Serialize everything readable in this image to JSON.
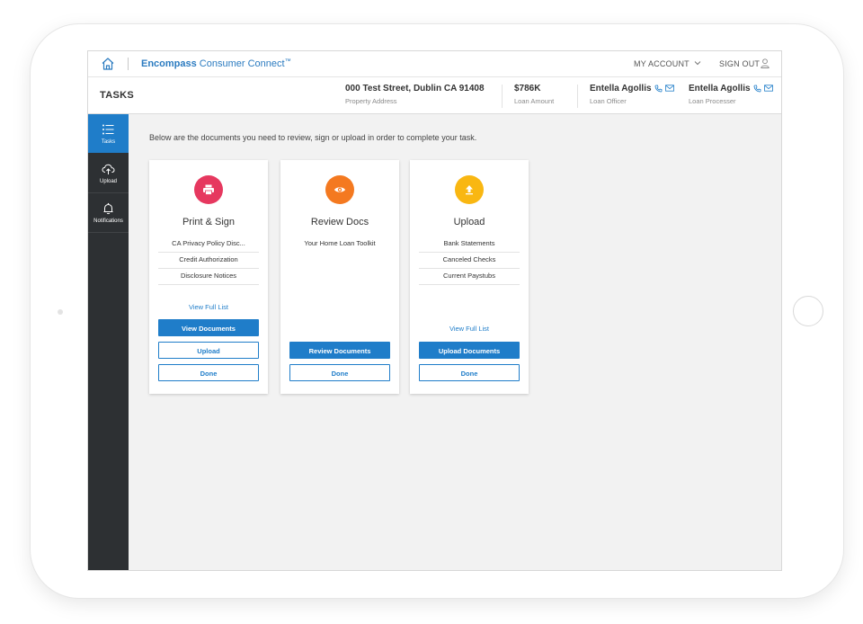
{
  "colors": {
    "accent": "#1f7dc9",
    "sidebar_bg": "#2d3033",
    "print_sign": "#e6385f",
    "review_docs": "#f47920",
    "upload": "#f9b712"
  },
  "topbar": {
    "brand_bold": "Encompass",
    "brand_light": " Consumer Connect",
    "brand_mark": "™",
    "my_account": "MY ACCOUNT",
    "sign_out": "SIGN OUT"
  },
  "header": {
    "page_title": "TASKS",
    "address": "000 Test Street, Dublin CA 91408",
    "address_label": "Property Address",
    "loan_amount": "$786K",
    "loan_amount_label": "Loan Amount",
    "loan_officer": "Entella Agollis",
    "loan_officer_label": "Loan Officer",
    "loan_processor": "Entella Agollis",
    "loan_processor_label": "Loan Processer"
  },
  "sidebar": {
    "items": [
      {
        "label": "Tasks",
        "icon": "list-icon"
      },
      {
        "label": "Upload",
        "icon": "cloud-upload-icon"
      },
      {
        "label": "Notifications",
        "icon": "bell-icon"
      }
    ]
  },
  "main": {
    "intro": "Below are the documents you need to review, sign or upload in order to complete your task."
  },
  "cards": [
    {
      "title": "Print & Sign",
      "icon": "printer-icon",
      "docs": [
        "CA Privacy Policy Disc...",
        "Credit Authorization",
        "Disclosure Notices"
      ],
      "link": "View Full List",
      "buttons": [
        "View Documents",
        "Upload",
        "Done"
      ]
    },
    {
      "title": "Review Docs",
      "icon": "eye-icon",
      "docs": [
        "Your Home Loan Toolkit"
      ],
      "buttons": [
        "Review Documents",
        "Done"
      ]
    },
    {
      "title": "Upload",
      "icon": "upload-arrow-icon",
      "docs": [
        "Bank Statements",
        "Canceled Checks",
        "Current Paystubs"
      ],
      "link": "View Full List",
      "buttons": [
        "Upload Documents",
        "Done"
      ]
    }
  ]
}
